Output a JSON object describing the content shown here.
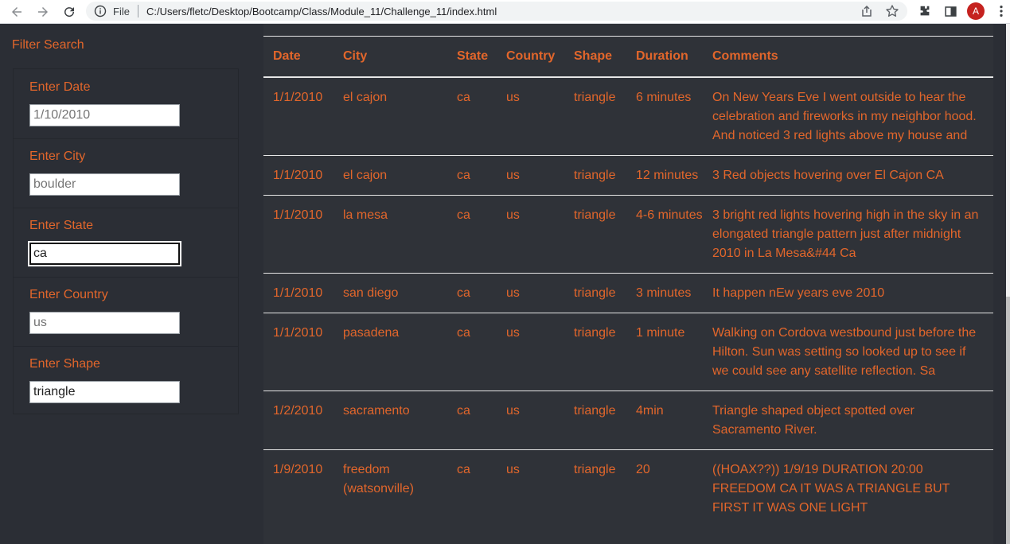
{
  "browser": {
    "scheme_label": "File",
    "url": "C:/Users/fletc/Desktop/Bootcamp/Class/Module_11/Challenge_11/index.html",
    "profile_initial": "A",
    "profile_color": "#c5221f"
  },
  "page": {
    "accent_color": "#e2662b",
    "background_color": "#2b2e35",
    "filter_title": "Filter Search",
    "filters": [
      {
        "label": "Enter Date",
        "value": "",
        "placeholder": "1/10/2010"
      },
      {
        "label": "Enter City",
        "value": "",
        "placeholder": "boulder"
      },
      {
        "label": "Enter State",
        "value": "ca",
        "placeholder": "",
        "focused": true
      },
      {
        "label": "Enter Country",
        "value": "",
        "placeholder": "us"
      },
      {
        "label": "Enter Shape",
        "value": "triangle",
        "placeholder": ""
      }
    ],
    "table": {
      "headers": [
        "Date",
        "City",
        "State",
        "Country",
        "Shape",
        "Duration",
        "Comments"
      ],
      "rows": [
        [
          "1/1/2010",
          "el cajon",
          "ca",
          "us",
          "triangle",
          "6 minutes",
          "On New Years Eve I went outside to hear the celebration and fireworks in my neighbor hood. And noticed 3 red lights above my house and"
        ],
        [
          "1/1/2010",
          "el cajon",
          "ca",
          "us",
          "triangle",
          "12 minutes",
          "3 Red objects hovering over El Cajon CA"
        ],
        [
          "1/1/2010",
          "la mesa",
          "ca",
          "us",
          "triangle",
          "4-6 minutes",
          "3 bright red lights hovering high in the sky in an elongated triangle pattern just after midnight 2010 in La Mesa&#44 Ca"
        ],
        [
          "1/1/2010",
          "san diego",
          "ca",
          "us",
          "triangle",
          "3 minutes",
          "It happen nEw years eve 2010"
        ],
        [
          "1/1/2010",
          "pasadena",
          "ca",
          "us",
          "triangle",
          "1 minute",
          "Walking on Cordova westbound just before the Hilton. Sun was setting so looked up to see if we could see any satellite reflection. Sa"
        ],
        [
          "1/2/2010",
          "sacramento",
          "ca",
          "us",
          "triangle",
          "4min",
          "Triangle shaped object spotted over Sacramento River."
        ],
        [
          "1/9/2010",
          "freedom (watsonville)",
          "ca",
          "us",
          "triangle",
          "20",
          "((HOAX??)) 1/9/19 DURATION 20:00 FREEDOM CA IT WAS A TRIANGLE BUT FIRST IT WAS ONE LIGHT"
        ]
      ]
    }
  }
}
